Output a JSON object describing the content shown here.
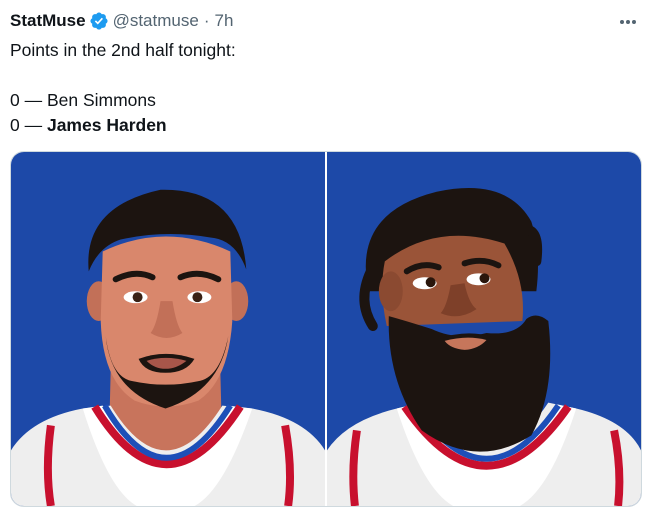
{
  "tweet": {
    "author_name": "StatMuse",
    "handle": "@statmuse",
    "separator": "·",
    "time": "7h",
    "text_line1": "Points in the 2nd half tonight:",
    "line2_number": "0",
    "line2_dash": " — ",
    "line2_name": "Ben Simmons",
    "line3_number": "0",
    "line3_dash": " — ",
    "line3_name": "James Harden"
  },
  "media": {
    "left_image": "ben-simmons-illustration",
    "right_image": "james-harden-illustration"
  },
  "colors": {
    "panel_bg": "#1d49a8",
    "verified": "#1d9bf0",
    "secondary_text": "#536471"
  },
  "icons": {
    "verified": "verified-badge-icon",
    "more": "more-options-icon"
  }
}
